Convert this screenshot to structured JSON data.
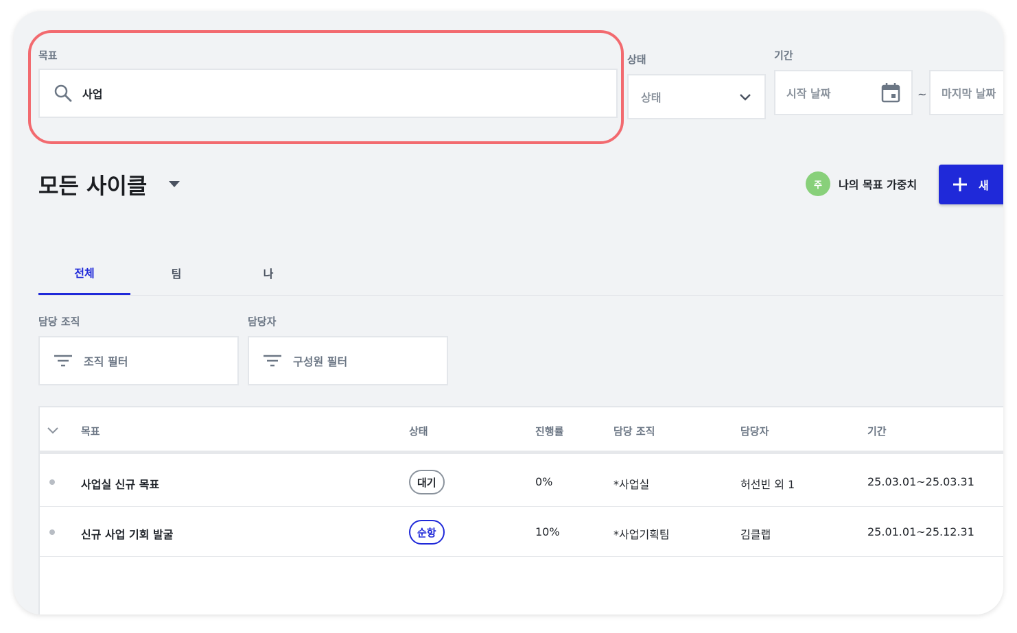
{
  "filters": {
    "goal_label": "목표",
    "goal_value": "사업",
    "status_label": "상태",
    "status_placeholder": "상태",
    "period_label": "기간",
    "start_date_placeholder": "시작 날짜",
    "end_date_placeholder": "마지막 날짜",
    "date_separator": "~"
  },
  "header": {
    "title": "모든 사이클",
    "weight_avatar": "주",
    "weight_label": "나의 목표 가중치",
    "new_button_label": "새"
  },
  "tabs": [
    {
      "label": "전체",
      "active": true
    },
    {
      "label": "팀",
      "active": false
    },
    {
      "label": "나",
      "active": false
    }
  ],
  "sub_filters": {
    "org_label": "담당 조직",
    "org_placeholder": "조직 필터",
    "assignee_label": "담당자",
    "assignee_placeholder": "구성원 필터"
  },
  "table": {
    "columns": [
      "목표",
      "상태",
      "진행률",
      "담당 조직",
      "담당자",
      "기간"
    ],
    "rows": [
      {
        "goal": "사업실 신규 목표",
        "status": "대기",
        "progress": "0%",
        "org": "*사업실",
        "assignee": "허선빈 외 1",
        "period": "25.03.01~25.03.31"
      },
      {
        "goal": "신규 사업 기회 발굴",
        "status": "순항",
        "progress": "10%",
        "org": "*사업기획팀",
        "assignee": "김클랩",
        "period": "25.01.01~25.12.31"
      }
    ]
  },
  "colors": {
    "accent": "#1f29d9",
    "highlight": "#f26a6f",
    "avatar": "#88d07a"
  }
}
